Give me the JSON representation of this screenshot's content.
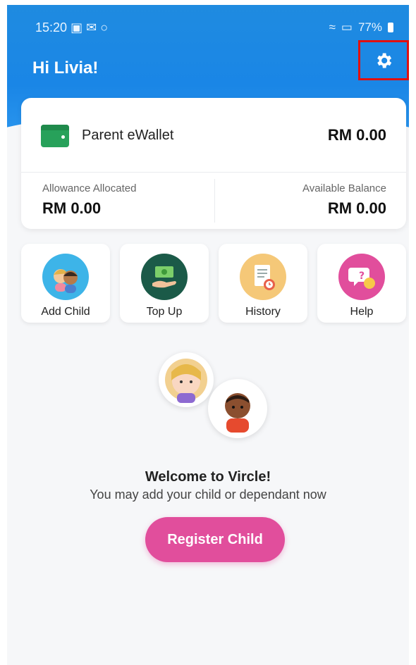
{
  "status_bar": {
    "time": "15:20",
    "battery_text": "77%",
    "icons": [
      "gallery-icon",
      "mail-icon",
      "message-icon",
      "wifi-icon",
      "signal-icon",
      "battery-icon"
    ]
  },
  "header": {
    "greeting": "Hi Livia!",
    "settings_icon": "gear-icon"
  },
  "wallet": {
    "label": "Parent eWallet",
    "amount": "RM 0.00",
    "allowance_label": "Allowance Allocated",
    "allowance_value": "RM 0.00",
    "available_label": "Available Balance",
    "available_value": "RM 0.00"
  },
  "actions": [
    {
      "label": "Add Child",
      "icon": "add-child-icon"
    },
    {
      "label": "Top Up",
      "icon": "top-up-icon"
    },
    {
      "label": "History",
      "icon": "history-icon"
    },
    {
      "label": "Help",
      "icon": "help-icon"
    }
  ],
  "welcome": {
    "title": "Welcome to Vircle!",
    "subtitle": "You may add your child or dependant now",
    "button": "Register Child"
  },
  "colors": {
    "header_blue": "#1f8be0",
    "wallet_green": "#27a15a",
    "button_pink": "#e14e9c",
    "highlight_red": "#e01010"
  }
}
